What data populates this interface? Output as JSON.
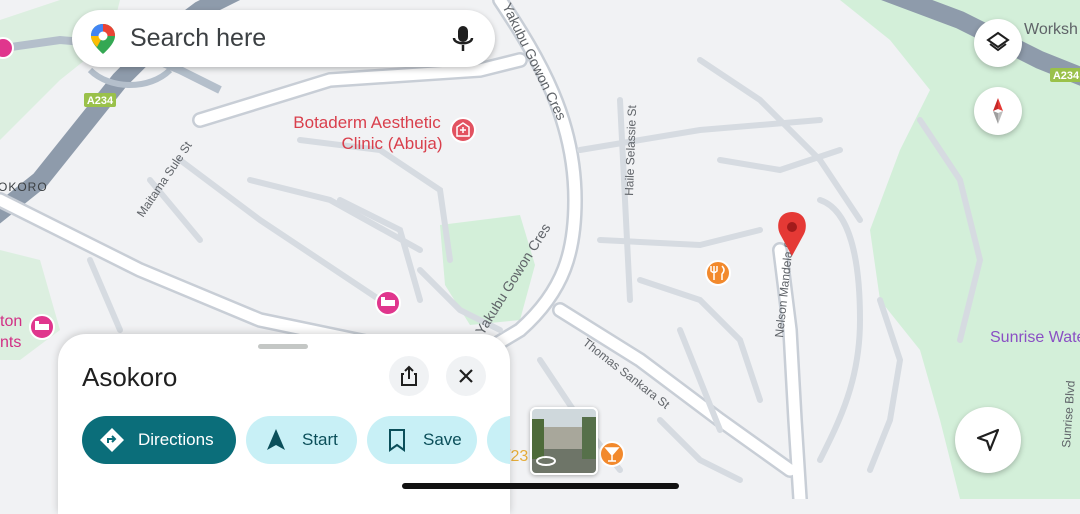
{
  "search": {
    "placeholder": "Search here"
  },
  "map": {
    "labels": {
      "clinic_line1": "Botaderm Aesthetic",
      "clinic_line2": "Clinic (Abuja)",
      "yakubu_gowon_north": "Yakubu Gowon Cres",
      "yakubu_gowon_south": "Yakubu Gowon Cres",
      "haile_selassie": "Haile Selassie St",
      "maitama_sule": "Maitama Sule St",
      "thomas_sankara": "Thomas Sankara St",
      "nelson_mandela": "Nelson Mandela St",
      "sunrise_water": "Sunrise Wate",
      "sunrise_blvd": "Sunrise Blvd",
      "worksh": "Worksh",
      "asokoro_edge": "OKORO",
      "hotel_left_line1": "ton",
      "hotel_left_line2": "nts",
      "a234_left": "A234",
      "a234_right": "A234",
      "partial_road_number": "/23"
    },
    "colors": {
      "background": "#f1f2f4",
      "park": "#d3efd9",
      "road": "#ffffff",
      "road_outline": "#c8ced6",
      "highway": "#8e9bab",
      "poi_pink": "#e0368d",
      "poi_red": "#e25260",
      "poi_orange": "#f2892c",
      "pin_red": "#e53935"
    }
  },
  "sheet": {
    "title": "Asokoro",
    "actions": {
      "directions": "Directions",
      "start": "Start",
      "save": "Save"
    }
  },
  "icons": {
    "layers": "layers-icon",
    "compass": "compass-icon",
    "my_location": "navigation-arrow-icon",
    "share": "share-icon",
    "close": "close-icon",
    "mic": "mic-icon"
  }
}
